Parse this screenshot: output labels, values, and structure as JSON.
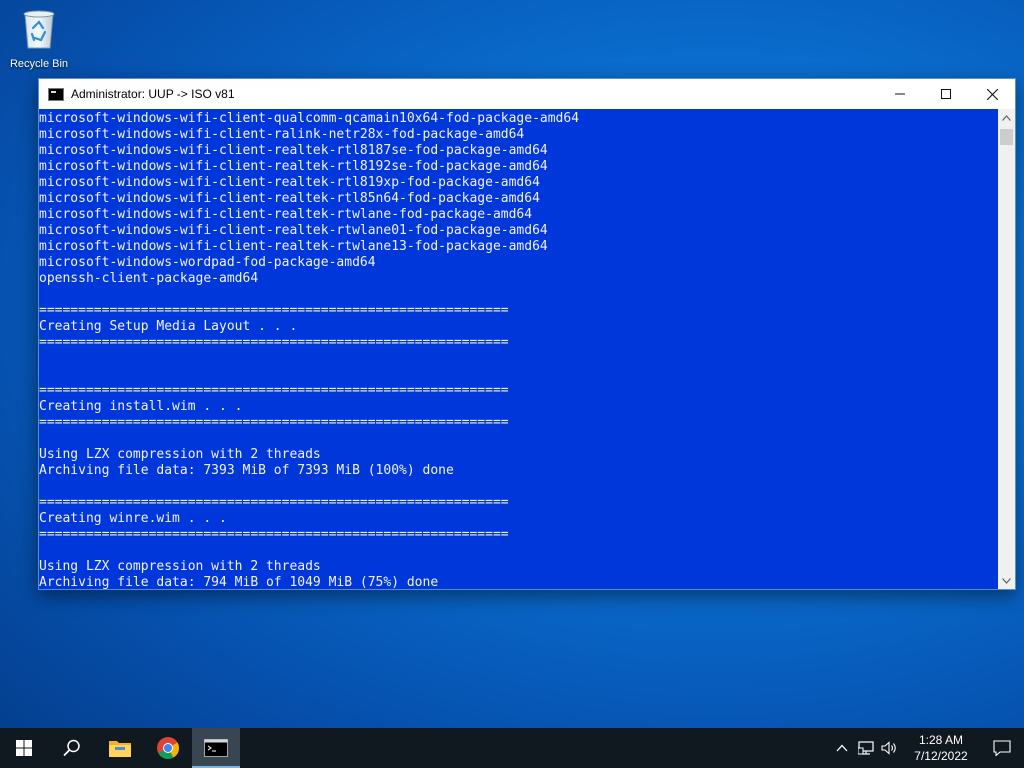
{
  "desktop": {
    "icons": [
      {
        "label": "Recycle Bin",
        "icon": "recycle-bin-icon"
      }
    ]
  },
  "window": {
    "title": "Administrator:  UUP -> ISO v81",
    "icon": "console-icon",
    "controls": {
      "minimize": "─",
      "maximize": "☐",
      "close": "✕"
    },
    "colors": {
      "console_background": "#0037da",
      "console_text": "#f2f2f2"
    },
    "console_lines": [
      "microsoft-windows-wifi-client-qualcomm-qcamain10x64-fod-package-amd64",
      "microsoft-windows-wifi-client-ralink-netr28x-fod-package-amd64",
      "microsoft-windows-wifi-client-realtek-rtl8187se-fod-package-amd64",
      "microsoft-windows-wifi-client-realtek-rtl8192se-fod-package-amd64",
      "microsoft-windows-wifi-client-realtek-rtl819xp-fod-package-amd64",
      "microsoft-windows-wifi-client-realtek-rtl85n64-fod-package-amd64",
      "microsoft-windows-wifi-client-realtek-rtwlane-fod-package-amd64",
      "microsoft-windows-wifi-client-realtek-rtwlane01-fod-package-amd64",
      "microsoft-windows-wifi-client-realtek-rtwlane13-fod-package-amd64",
      "microsoft-windows-wordpad-fod-package-amd64",
      "openssh-client-package-amd64",
      "",
      "============================================================",
      "Creating Setup Media Layout . . .",
      "============================================================",
      "",
      "",
      "============================================================",
      "Creating install.wim . . .",
      "============================================================",
      "",
      "Using LZX compression with 2 threads",
      "Archiving file data: 7393 MiB of 7393 MiB (100%) done",
      "",
      "============================================================",
      "Creating winre.wim . . .",
      "============================================================",
      "",
      "Using LZX compression with 2 threads",
      "Archiving file data: 794 MiB of 1049 MiB (75%) done"
    ]
  },
  "taskbar": {
    "colors": {
      "background": "#101820",
      "active_indicator": "#76b9ed"
    },
    "pinned": [
      {
        "name": "start-button",
        "icon": "windows-logo-icon",
        "active": false
      },
      {
        "name": "search-button",
        "icon": "search-icon",
        "active": false
      },
      {
        "name": "file-explorer-button",
        "icon": "folder-icon",
        "active": false
      },
      {
        "name": "chrome-button",
        "icon": "chrome-icon",
        "active": false
      },
      {
        "name": "command-prompt-button",
        "icon": "console-icon",
        "active": true
      }
    ],
    "tray": {
      "icons": [
        "chevron-up-icon",
        "network-icon",
        "volume-icon"
      ],
      "time": "1:28 AM",
      "date": "7/12/2022",
      "notification_icon": "notification-icon"
    }
  }
}
